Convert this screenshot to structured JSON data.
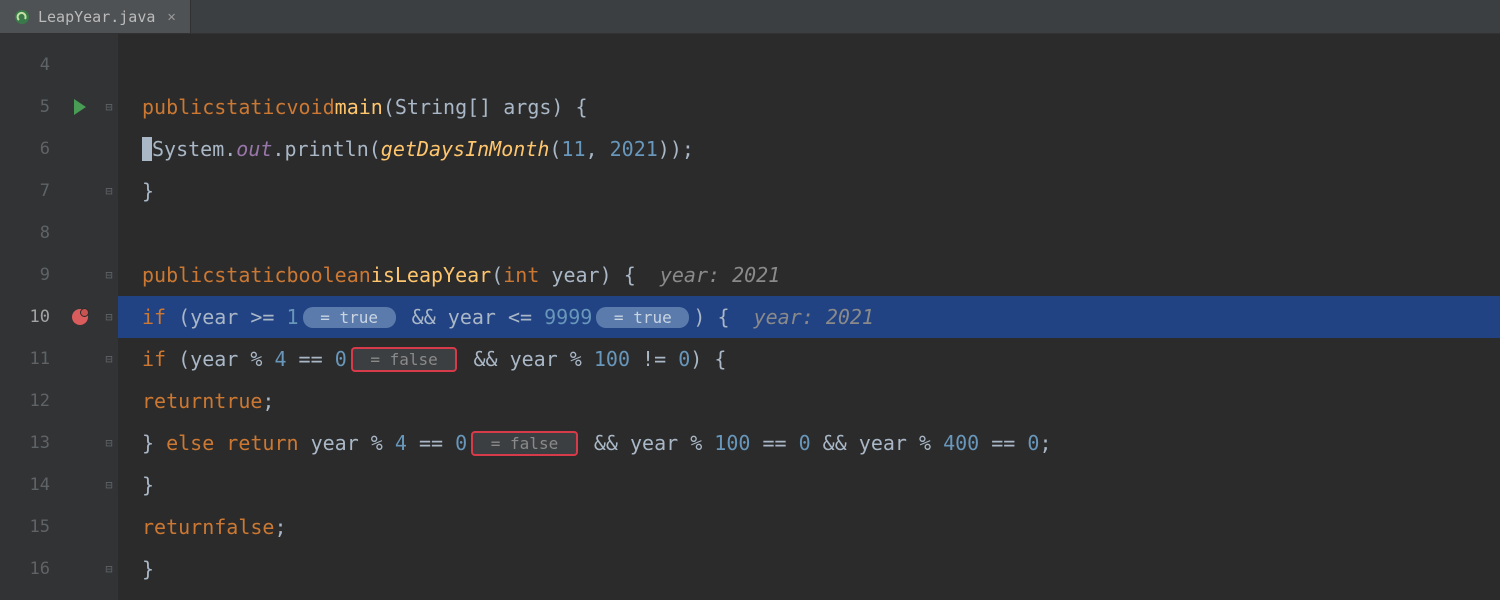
{
  "tab": {
    "filename": "LeapYear.java"
  },
  "lines": {
    "l4": "4",
    "l5": "5",
    "l6": "6",
    "l7": "7",
    "l8": "8",
    "l9": "9",
    "l10": "10",
    "l11": "11",
    "l12": "12",
    "l13": "13",
    "l14": "14",
    "l15": "15",
    "l16": "16"
  },
  "code": {
    "l5": {
      "kw1": "public",
      "kw2": "static",
      "ty": "void",
      "name": "main",
      "params": "(String[] args) {"
    },
    "l6": {
      "sys": "System.",
      "out": "out",
      "print": ".println(",
      "call": "getDaysInMonth",
      "args": "(",
      "n1": "11",
      "c1": ", ",
      "n2": "2021",
      "tail": "));"
    },
    "l7": {
      "brace": "}"
    },
    "l9": {
      "kw1": "public",
      "kw2": "static",
      "ty": "boolean",
      "name": "isLeapYear",
      "p_open": "(",
      "p_ty": "int",
      "p_name": " year",
      "p_close": ") {",
      "hint": "  year: 2021"
    },
    "l10": {
      "kw": "if",
      "open": " (year >= ",
      "n1": "1",
      "inlay1": " = true ",
      "mid": " && year <= ",
      "n2": "9999",
      "inlay2": " = true ",
      "close": ") {",
      "hint": "  year: 2021"
    },
    "l11": {
      "kw": "if",
      "open": " (year % ",
      "n1": "4",
      "eq": " == ",
      "n2": "0",
      "inlay": " = false ",
      "mid": " && year % ",
      "n3": "100",
      "tail": " != ",
      "n4": "0",
      "close": ") {"
    },
    "l12": {
      "kw": "return",
      "val": "true",
      "e": ";"
    },
    "l13": {
      "b": "}",
      "kw1": " else ",
      "kw2": "return",
      "mid": " year % ",
      "n1": "4",
      "eq": " == ",
      "n2": "0",
      "inlay": " = false ",
      "m2": " && year % ",
      "n3": "100",
      "eq2": " == ",
      "n4": "0",
      "m3": " && year % ",
      "n5": "400",
      "eq3": " == ",
      "n6": "0",
      "e": ";"
    },
    "l14": {
      "b": "}"
    },
    "l15": {
      "kw": "return",
      "val": "false",
      "e": ";"
    },
    "l16": {
      "b": "}"
    }
  }
}
